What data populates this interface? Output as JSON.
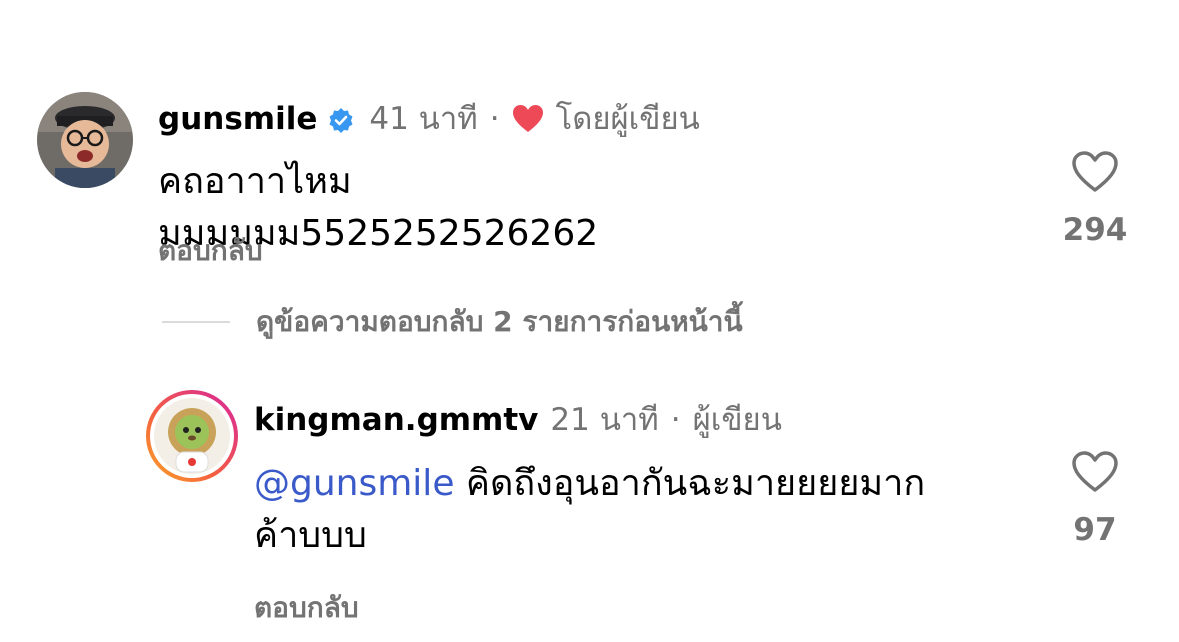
{
  "comments": [
    {
      "username": "gunsmile",
      "verified": true,
      "time": "41 นาที",
      "separator": "·",
      "liked_by_author_label": "โดยผู้เขียน",
      "text": "คถอาาาไหมมมมมมม5525252526262",
      "reply_label": "ตอบกลับ",
      "like_count": "294",
      "icons": {
        "verified": "verified-badge-icon",
        "heart_author": "red-heart-icon",
        "like": "heart-outline-icon"
      }
    },
    {
      "username": "kingman.gmmtv",
      "time": "21 นาที",
      "separator": "·",
      "author_label": "ผู้เขียน",
      "mention": "@gunsmile",
      "text_line1": "คิดถึงอุนอากันฉะมายยยยมาก",
      "text_line2": "ค้าบบบ",
      "reply_label": "ตอบกลับ",
      "like_count": "97",
      "icons": {
        "like": "heart-outline-icon"
      }
    }
  ],
  "view_replies_label": "ดูข้อความตอบกลับ 2 รายการก่อนหน้านี้",
  "colors": {
    "secondary_text": "#737373",
    "mention": "#3b5ac9",
    "verified": "#3897f0",
    "heart_red": "#ed4956",
    "story_ring_start": "#f9a825",
    "story_ring_end": "#d6249f"
  }
}
